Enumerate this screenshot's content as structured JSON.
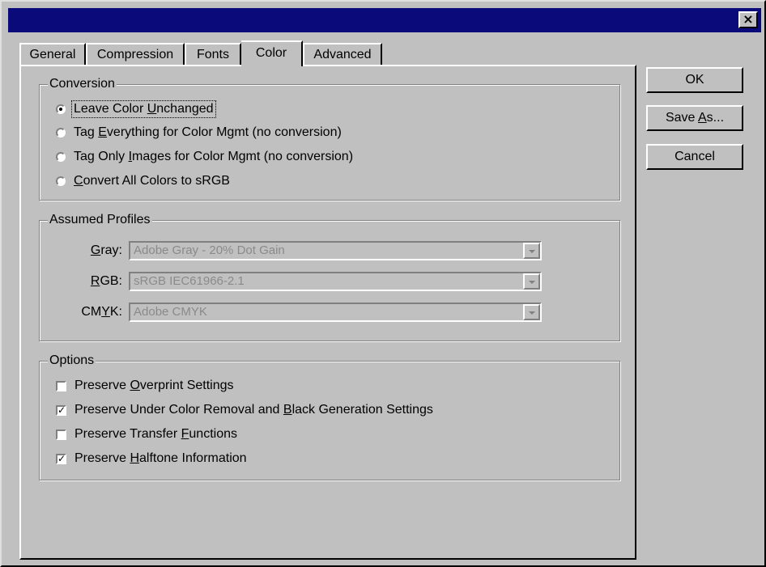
{
  "window": {
    "close_label": "×"
  },
  "tabs": [
    "General",
    "Compression",
    "Fonts",
    "Color",
    "Advanced"
  ],
  "conversion": {
    "legend": "Conversion",
    "options": [
      {
        "label_pre": "Leave Color ",
        "label_u": "U",
        "label_post": "nchanged",
        "selected": true
      },
      {
        "label_pre": "Tag ",
        "label_u": "E",
        "label_post": "verything for Color Mgmt (no conversion)",
        "selected": false
      },
      {
        "label_pre": "Tag Only ",
        "label_u": "I",
        "label_post": "mages for Color Mgmt (no conversion)",
        "selected": false
      },
      {
        "label_pre": "",
        "label_u": "C",
        "label_post": "onvert All Colors to sRGB",
        "selected": false
      }
    ]
  },
  "profiles": {
    "legend": "Assumed Profiles",
    "gray": {
      "label_pre": "",
      "label_u": "G",
      "label_post": "ray:",
      "value": "Adobe Gray - 20% Dot Gain"
    },
    "rgb": {
      "label_pre": "",
      "label_u": "R",
      "label_post": "GB:",
      "value": "sRGB IEC61966-2.1"
    },
    "cmyk": {
      "label_pre": "CM",
      "label_u": "Y",
      "label_post": "K:",
      "value": "Adobe CMYK"
    }
  },
  "options": {
    "legend": "Options",
    "items": [
      {
        "label_pre": "Preserve ",
        "label_u": "O",
        "label_post": "verprint Settings",
        "checked": false
      },
      {
        "label_pre": "Preserve Under Color Removal and ",
        "label_u": "B",
        "label_post": "lack Generation Settings",
        "checked": true
      },
      {
        "label_pre": "Preserve Transfer ",
        "label_u": "F",
        "label_post": "unctions",
        "checked": false
      },
      {
        "label_pre": "Preserve ",
        "label_u": "H",
        "label_post": "alftone Information",
        "checked": true
      }
    ]
  },
  "buttons": {
    "ok": "OK",
    "save_pre": "Save ",
    "save_u": "A",
    "save_post": "s...",
    "cancel": "Cancel"
  },
  "colors": {
    "titlebar": "#0a0a7a",
    "face": "#c0c0c0"
  }
}
